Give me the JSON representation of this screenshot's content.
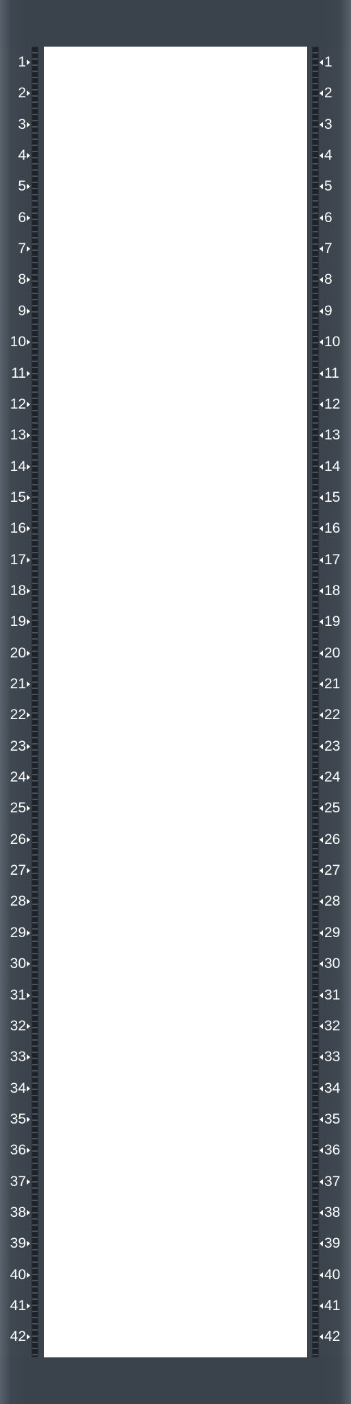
{
  "rack": {
    "units": [
      "1",
      "2",
      "3",
      "4",
      "5",
      "6",
      "7",
      "8",
      "9",
      "10",
      "11",
      "12",
      "13",
      "14",
      "15",
      "16",
      "17",
      "18",
      "19",
      "20",
      "21",
      "22",
      "23",
      "24",
      "25",
      "26",
      "27",
      "28",
      "29",
      "30",
      "31",
      "32",
      "33",
      "34",
      "35",
      "36",
      "37",
      "38",
      "39",
      "40",
      "41",
      "42"
    ],
    "left_arrow_icon": "triangle-right-icon",
    "right_arrow_icon": "triangle-left-icon",
    "colors": {
      "frame": "#3b434d",
      "bay": "#ffffff",
      "rail": "#1f2329",
      "label": "#ffffff"
    }
  }
}
